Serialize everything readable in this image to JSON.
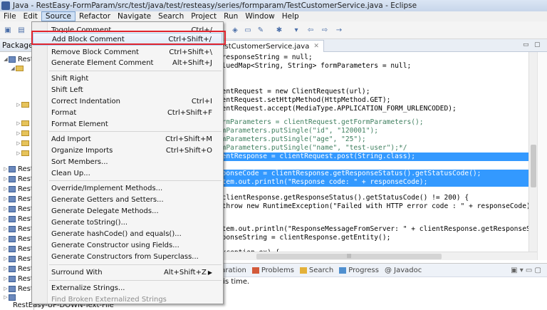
{
  "window": {
    "title": "Java - RestEasy-FormParam/src/test/java/test/resteasy/series/formparam/TestCustomerService.java - Eclipse"
  },
  "menubar": {
    "items": [
      {
        "id": "file",
        "label": "File"
      },
      {
        "id": "edit",
        "label": "Edit"
      },
      {
        "id": "source",
        "label": "Source"
      },
      {
        "id": "refactor",
        "label": "Refactor"
      },
      {
        "id": "navigate",
        "label": "Navigate"
      },
      {
        "id": "search",
        "label": "Search"
      },
      {
        "id": "project",
        "label": "Project"
      },
      {
        "id": "run",
        "label": "Run"
      },
      {
        "id": "window",
        "label": "Window"
      },
      {
        "id": "help",
        "label": "Help"
      }
    ]
  },
  "package_explorer": {
    "title": "Package Explorer",
    "rows": [
      "Rest",
      "Rest",
      "Rest",
      "Rest",
      "Rest",
      "Rest",
      "Rest",
      "Rest",
      "Rest",
      "Rest",
      "Rest",
      "Rest",
      "Rest",
      "Rest"
    ],
    "last_row": "RestEasy-UP-DOWN-Text-File"
  },
  "editor": {
    "tab_label": "TestCustomerService.java",
    "lines": [
      "g responseString = null;",
      "ValuedMap<String, String> formParameters = null;",
      "",
      "",
      "lientRequest = new ClientRequest(url);",
      "lientRequest.setHttpMethod(HttpMethod.GET);",
      "lientRequest.accept(MediaType.APPLICATION_FORM_URLENCODED);",
      "",
      "formParameters = clientRequest.getFormParameters();",
      "ormParameters.putSingle(\"id\", \"120001\");",
      "ormParameters.putSingle(\"age\", \"25\");",
      "ormParameters.putSingle(\"name\", \"test-user\");*/",
      "",
      "lientResponse = clientRequest.post(String.class);",
      "",
      "esponseCode = clientResponse.getResponseStatus().getStatusCode();",
      "ystem.out.println(\"Response code: \" + responseCode);",
      "",
      "f(clientResponse.getResponseStatus().getStatusCode() != 200) {",
      "  throw new RuntimeException(\"Failed with HTTP error code : \" + responseCode);",
      "",
      "",
      "ystem.out.println(\"ResponseMessageFromServer: \" + clientResponse.getResponseStatus().g",
      "esponseString = clientResponse.getEntity();",
      "",
      "",
      "(Exception ex) {"
    ]
  },
  "source_menu": {
    "items": [
      {
        "label": "Toggle Comment",
        "shortcut": "Ctrl+/"
      },
      {
        "label": "Add Block Comment",
        "shortcut": "Ctrl+Shift+/"
      },
      {
        "label": "Remove Block Comment",
        "shortcut": "Ctrl+Shift+\\"
      },
      {
        "label": "Generate Element Comment",
        "shortcut": "Alt+Shift+J"
      },
      {
        "label": "Shift Right",
        "shortcut": ""
      },
      {
        "label": "Shift Left",
        "shortcut": ""
      },
      {
        "label": "Correct Indentation",
        "shortcut": "Ctrl+I"
      },
      {
        "label": "Format",
        "shortcut": "Ctrl+Shift+F"
      },
      {
        "label": "Format Element",
        "shortcut": ""
      },
      {
        "label": "Add Import",
        "shortcut": "Ctrl+Shift+M"
      },
      {
        "label": "Organize Imports",
        "shortcut": "Ctrl+Shift+O"
      },
      {
        "label": "Sort Members...",
        "shortcut": ""
      },
      {
        "label": "Clean Up...",
        "shortcut": ""
      },
      {
        "label": "Override/Implement Methods...",
        "shortcut": ""
      },
      {
        "label": "Generate Getters and Setters...",
        "shortcut": ""
      },
      {
        "label": "Generate Delegate Methods...",
        "shortcut": ""
      },
      {
        "label": "Generate toString()...",
        "shortcut": ""
      },
      {
        "label": "Generate hashCode() and equals()...",
        "shortcut": ""
      },
      {
        "label": "Generate Constructor using Fields...",
        "shortcut": ""
      },
      {
        "label": "Generate Constructors from Superclass...",
        "shortcut": ""
      },
      {
        "label": "Surround With",
        "shortcut": "Alt+Shift+Z"
      },
      {
        "label": "Externalize Strings...",
        "shortcut": ""
      },
      {
        "label": "Find Broken Externalized Strings",
        "shortcut": ""
      }
    ]
  },
  "bottom_panel": {
    "tabs": [
      {
        "label": "claration"
      },
      {
        "label": "Problems"
      },
      {
        "label": "Search"
      },
      {
        "label": "Progress"
      },
      {
        "label": "@ Javadoc"
      }
    ],
    "message": "this time."
  },
  "colors": {
    "selection": "#3399ff",
    "highlight_box": "#e0232d",
    "menu_hover": "#dfeaf8"
  }
}
